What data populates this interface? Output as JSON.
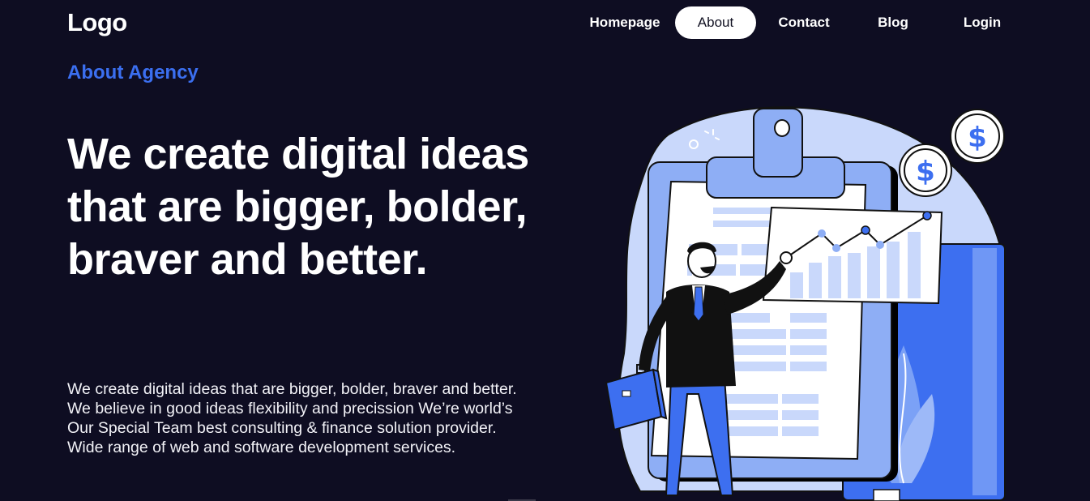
{
  "header": {
    "logo": "Logo",
    "nav": [
      {
        "label": "Homepage",
        "active": false
      },
      {
        "label": "About",
        "active": true
      },
      {
        "label": "Contact",
        "active": false
      },
      {
        "label": "Blog",
        "active": false
      },
      {
        "label": "Login",
        "active": false
      }
    ]
  },
  "hero": {
    "eyebrow": "About Agency",
    "headline": "We create digital ideas that are bigger, bolder, braver and better.",
    "body": "We create digital ideas that are bigger, bolder, braver and better. We believe in good ideas flexibility and precission We’re world’s Our Special Team best consulting & finance solution provider. Wide range of web and software development services."
  },
  "illustration": {
    "currency_symbol": "$",
    "icons": [
      "clipboard-icon",
      "chart-icon",
      "businessman",
      "briefcase-icon",
      "dollar-coin-icon",
      "plant-icon"
    ]
  },
  "colors": {
    "background": "#0e0d22",
    "accent": "#3b6ff0",
    "light_blue": "#c9d8fb",
    "mid_blue": "#8eaef5",
    "active_nav_bg": "#ffffff"
  }
}
